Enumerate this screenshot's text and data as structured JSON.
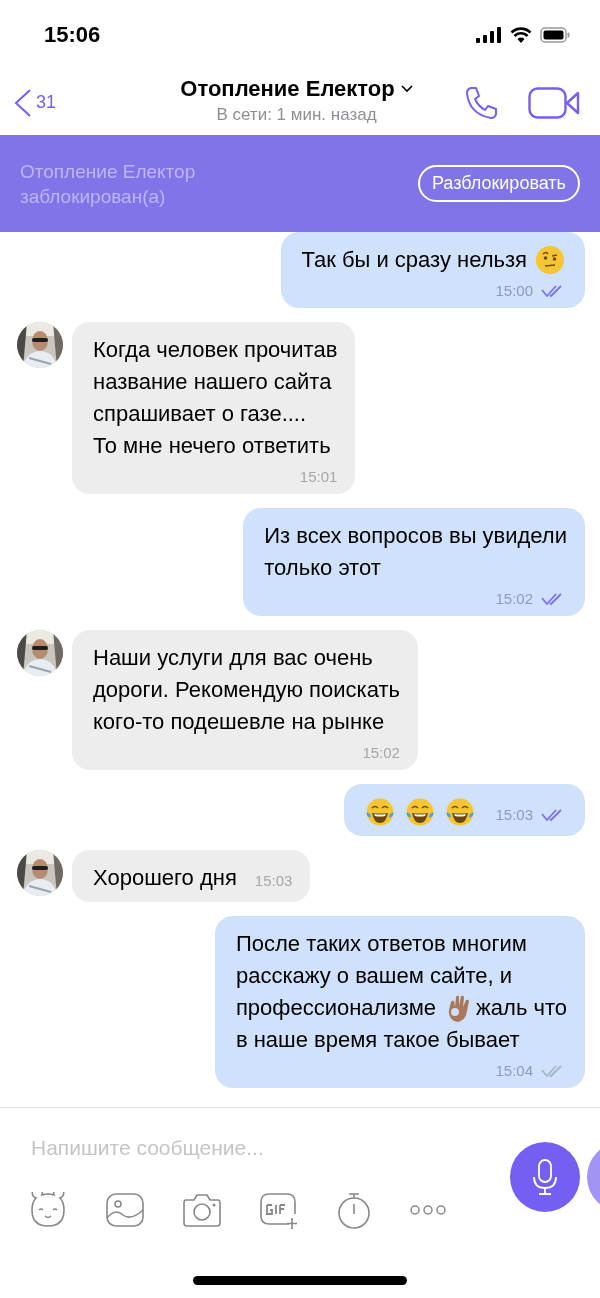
{
  "status_bar": {
    "time": "15:06"
  },
  "header": {
    "back_count": "31",
    "title": "Отопление Електор",
    "subtitle": "В сети: 1 мин. назад"
  },
  "banner": {
    "text": "Отопление Електор заблокирован(а)",
    "button": "Разблокировать"
  },
  "messages": [
    {
      "kind": "outgoing",
      "lines": [
        [
          {
            "kind": "text",
            "text": "Так бы и сразу нельзя"
          },
          {
            "kind": "raised-eyebrow-emoji"
          }
        ]
      ],
      "time": "15:00",
      "read": true
    },
    {
      "kind": "incoming",
      "lines": [
        [
          {
            "kind": "text",
            "text": "Когда человек прочитав"
          }
        ],
        [
          {
            "kind": "text",
            "text": "название нашего сайта"
          }
        ],
        [
          {
            "kind": "text",
            "text": "спрашивает о газе...."
          }
        ],
        [
          {
            "kind": "text",
            "text": "То мне нечего ответить"
          }
        ]
      ],
      "time": "15:01"
    },
    {
      "kind": "outgoing",
      "lines": [
        [
          {
            "kind": "text",
            "text": "Из всех вопросов вы увидели"
          }
        ],
        [
          {
            "kind": "text",
            "text": "только этот"
          }
        ]
      ],
      "time": "15:02",
      "read": true
    },
    {
      "kind": "incoming",
      "lines": [
        [
          {
            "kind": "text",
            "text": "Наши услуги для вас очень"
          }
        ],
        [
          {
            "kind": "text",
            "text": "дороги. Рекомендую поискать"
          }
        ],
        [
          {
            "kind": "text",
            "text": "кого-то подешевле на рынке"
          }
        ]
      ],
      "time": "15:02"
    },
    {
      "kind": "outgoing",
      "lines": [
        [
          {
            "kind": "tears-of-joy-emoji"
          },
          {
            "kind": "tears-of-joy-emoji"
          },
          {
            "kind": "tears-of-joy-emoji"
          }
        ]
      ],
      "time": "15:03",
      "read": true
    },
    {
      "kind": "incoming",
      "lines": [
        [
          {
            "kind": "text",
            "text": "Хорошего дня"
          }
        ]
      ],
      "time": "15:03"
    },
    {
      "kind": "outgoing",
      "lines": [
        [
          {
            "kind": "text",
            "text": "После таких ответов многим"
          }
        ],
        [
          {
            "kind": "text",
            "text": "расскажу о вашем сайте, и"
          }
        ],
        [
          {
            "kind": "text",
            "text": "профессионализме"
          },
          {
            "kind": "ok-hand-emoji"
          },
          {
            "kind": "text",
            "text": "жаль что"
          }
        ],
        [
          {
            "kind": "text",
            "text": "в наше время такое бывает"
          }
        ]
      ],
      "time": "15:04",
      "read": false
    }
  ],
  "composer": {
    "placeholder": "Напишите сообщение..."
  }
}
